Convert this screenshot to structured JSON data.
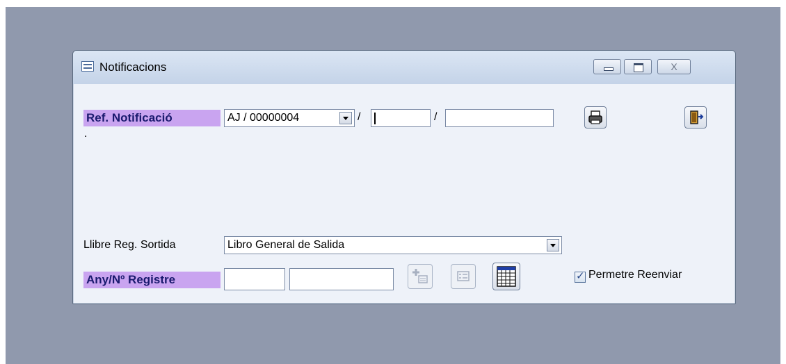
{
  "window": {
    "title": "Notificacions",
    "controls": {
      "minimize": "minimize",
      "maximize": "maximize",
      "close": "X"
    }
  },
  "ref_notificacio": {
    "label": "Ref. Notificació",
    "prefix_value": "AJ / 00000004",
    "separator1": "/",
    "field2_value": "",
    "separator2": "/",
    "field3_value": ""
  },
  "toolbar": {
    "print_icon": "printer-icon",
    "exit_icon": "exit-door-icon"
  },
  "info_text": ".",
  "llibre_reg": {
    "label": "Llibre Reg. Sortida",
    "value": "Libro General de Salida"
  },
  "any_registre": {
    "label": "Any/Nº Registre",
    "year_value": "",
    "number_value": ""
  },
  "registre_buttons": {
    "add_icon": "add-record-icon",
    "form_icon": "form-icon",
    "grid_icon": "grid-table-icon"
  },
  "permetre_reenviar": {
    "label": "Permetre Reenviar",
    "checked": true
  },
  "colors": {
    "desktop": "#9099ad",
    "window_bg": "#eef2f9",
    "label_highlight": "#c9a4f0",
    "label_text": "#1a1a6e"
  }
}
